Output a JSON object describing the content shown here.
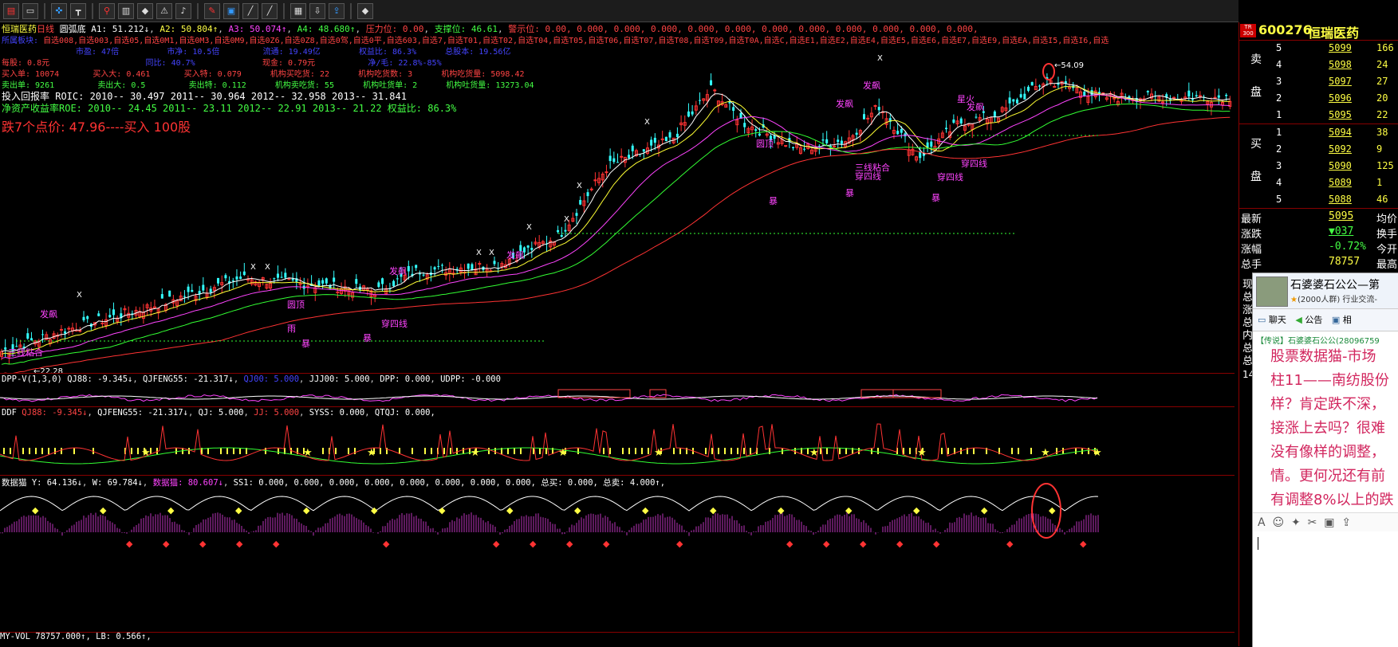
{
  "colors": {
    "up": "#ff3333",
    "down": "#33ffff",
    "ma1": "#ffffff",
    "ma2": "#ffff33",
    "ma3": "#ff44ff",
    "ma4": "#33ff33",
    "ma5": "#ff3333",
    "text_yellow": "#ffff00",
    "text_magenta": "#ff44ff",
    "text_cyan": "#33ffff",
    "text_red": "#ff3333"
  },
  "toolbar": {
    "icons": [
      "app-logo-icon",
      "window-icon",
      "crosshair-icon",
      "draw-line-icon",
      "person-icon",
      "bar-indicator-icon",
      "diamond-icon",
      "warning-icon",
      "bell-icon",
      "pen-icon",
      "image-icon",
      "line-tool-icon",
      "line-tool-2-icon",
      "grid-icon",
      "download-icon",
      "share-icon",
      "diamond-2-icon"
    ]
  },
  "header": {
    "line1": {
      "name": "恒瑞医药",
      "period": "日线",
      "style": "圆弧底",
      "a1": "A1: 51.212↓",
      "a2": "A2: 50.804↑",
      "a3": "A3: 50.074↑",
      "a4": "A4: 48.680↑",
      "pressure": "压力位: 0.00",
      "support": "支撑位: 46.61",
      "warn": "警示位: 0.00, 0.000, 0.000, 0.000, 0.000, 0.000, 0.000, 0.000, 0.000, 0.000, 0.000, 0.000,"
    },
    "line2_label": "所属板块:",
    "line2": "自选008,自选003,自选05,自选0M1,自选0M3,自选0M9,自选0Z6,自选0Z8,自选0驾,自选0平,自选603,自选7,自选T01,自选T02,自选T04,自选T05,自选T06,自选T07,自选T08,自选T09,自选T0A,自选C,自选E1,自选E2,自选E4,自选E5,自选E6,自选E7,自选E9,自选EA,自选I5,自选I6,自选",
    "line3": {
      "pe": "市盈: 47倍",
      "mcap": "市净: 10.5倍",
      "float": "流通: 19.49亿",
      "rights": "权益比: 86.3%",
      "equity": "总股本: 19.56亿"
    },
    "line4": {
      "eps": "每股: 0.8元",
      "yoy": "同比: 40.7%",
      "cash": "现金: 0.79元",
      "margin": "净/毛: 22.8%-85%"
    },
    "line5": {
      "a": "买入单: 10074",
      "b": "买入大: 0.461",
      "c": "买入特: 0.079",
      "d": "机构买吃货: 22",
      "e": "机构吃货数: 3",
      "f": "机构吃货量: 5098.42"
    },
    "line6": {
      "a": "卖出单: 9261",
      "b": "卖出大: 0.5",
      "c": "卖出特: 0.112",
      "d": "机构卖吃货: 55",
      "e": "机构吐货单: 2",
      "f": "机构吐货量: 13273.04"
    },
    "roic": "投入回报率 ROIC: 2010-- 30.497     2011-- 30.964     2012-- 32.958     2013-- 31.841",
    "roe": "净资产收益率ROE: 2010-- 24.45     2011-- 23.11     2012-- 22.91     2013-- 21.22     权益比: 86.3%",
    "alert": "跌7个点价: 47.96----买入 100股"
  },
  "chart_data": {
    "type": "candlestick",
    "title": "恒瑞医药 日线",
    "y_marks": {
      "low_label": "22.28",
      "high_label": "54.09"
    },
    "annotations": [
      "发飙",
      "圆顶",
      "三线粘合",
      "穿四线",
      "雨",
      "暴",
      "星火"
    ],
    "note": "price series approximated; trend from ~22 to ~54"
  },
  "panels": {
    "dpp": {
      "label": "DPP-V(1,3,0)",
      "qj88": "QJ88: -9.345↓",
      "qjfeng": "QJFENG55: -21.317↓",
      "qj00": "QJ00: 5.000",
      "jjj00": "JJJ00: 5.000",
      "dpp": "DPP: 0.000",
      "udpp": "UDPP: -0.000"
    },
    "ddf": {
      "label": "DDF",
      "qj88": "QJ88: -9.345↓",
      "qjfeng": "QJFENG55: -21.317↓",
      "qj": "QJ: 5.000",
      "jj": "JJ: 5.000",
      "syss": "SYSS: 0.000",
      "qtqj": "QTQJ: 0.000,"
    },
    "cat": {
      "label": "数据猫",
      "y": "Y: 64.136↓",
      "w": "W: 69.784↓",
      "cat": "数据猫: 80.607↓",
      "ss1": "SS1: 0.000, 0.000, 0.000, 0.000, 0.000, 0.000, 0.000, 0.000,",
      "buy": "总买: 0.000,",
      "sell": "总卖: 4.000↑,"
    },
    "vol": {
      "label": "MY-VOL",
      "value": "78757.000↑,",
      "lb": "LB: 0.566↑,"
    }
  },
  "right": {
    "code": "600276",
    "name": "恒瑞医药",
    "tag": "TR 300",
    "sell_label": [
      "卖",
      "盘"
    ],
    "buy_label": [
      "买",
      "盘"
    ],
    "asks": [
      {
        "lvl": "5",
        "price": "5099",
        "vol": "166"
      },
      {
        "lvl": "4",
        "price": "5098",
        "vol": "24"
      },
      {
        "lvl": "3",
        "price": "5097",
        "vol": "27"
      },
      {
        "lvl": "2",
        "price": "5096",
        "vol": "20"
      },
      {
        "lvl": "1",
        "price": "5095",
        "vol": "22"
      }
    ],
    "bids": [
      {
        "lvl": "1",
        "price": "5094",
        "vol": "38"
      },
      {
        "lvl": "2",
        "price": "5092",
        "vol": "9"
      },
      {
        "lvl": "3",
        "price": "5090",
        "vol": "125"
      },
      {
        "lvl": "4",
        "price": "5089",
        "vol": "1"
      },
      {
        "lvl": "5",
        "price": "5088",
        "vol": "46"
      }
    ],
    "quotes": [
      {
        "k": "最新",
        "v": "5095",
        "k2": "均价"
      },
      {
        "k": "涨跌",
        "v": "▼037",
        "k2": "换手"
      },
      {
        "k": "涨幅",
        "v": "-0.72%",
        "k2": "今开"
      },
      {
        "k": "总手",
        "v": "78757",
        "k2": "最高"
      }
    ],
    "side_chars": [
      "现",
      "总",
      "涨",
      "总",
      "内",
      "总",
      "总"
    ],
    "num14": "14"
  },
  "chat": {
    "group": "石婆婆石公公—第",
    "sub": "(2000人群) 行业交流-",
    "tabs": [
      "聊天",
      "公告",
      "相"
    ],
    "legend": "【传说】石婆婆石公公(28096759",
    "lines": [
      "股票数据猫-市场",
      "柱11——南纺股份",
      "样？肯定跌不深，",
      "接涨上去吗？很难",
      "没有像样的调整，",
      "情。更何况还有前",
      "有调整8%以上的跌"
    ],
    "links": [
      "http://www.gpda",
      "r=news/view&id="
    ]
  }
}
